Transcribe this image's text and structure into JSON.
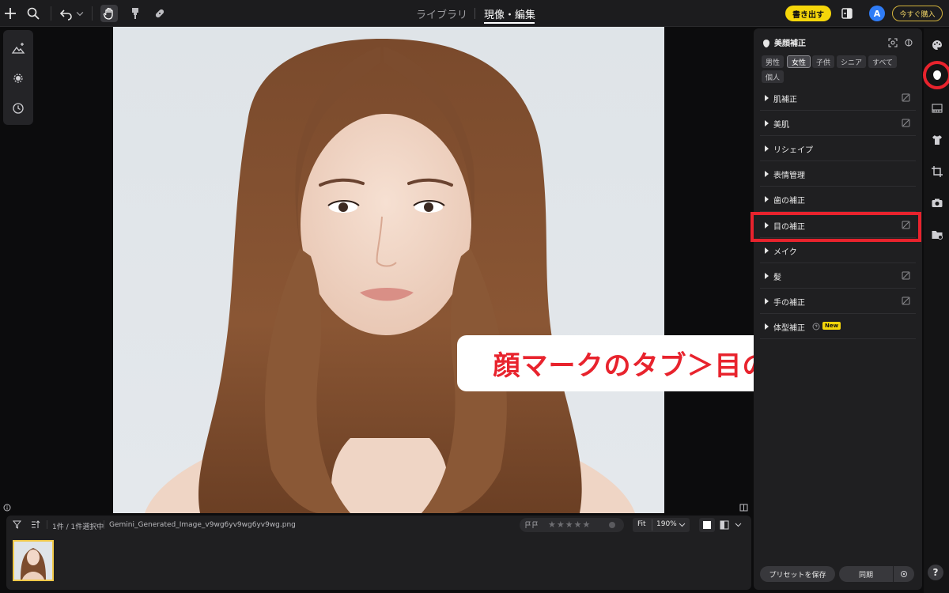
{
  "topbar": {
    "tab_library": "ライブラリ",
    "tab_develop": "現像・編集",
    "export_label": "書き出す",
    "avatar_letter": "A",
    "buy_label": "今すぐ購入"
  },
  "right_panel": {
    "title": "美顔補正",
    "chips": [
      "男性",
      "女性",
      "子供",
      "シニア",
      "すべて",
      "個人"
    ],
    "active_chip": "女性",
    "sections": [
      {
        "label": "肌補正",
        "eraser": true
      },
      {
        "label": "美肌",
        "eraser": true
      },
      {
        "label": "リシェイプ",
        "eraser": false
      },
      {
        "label": "表情管理",
        "eraser": false
      },
      {
        "label": "歯の補正",
        "eraser": false
      },
      {
        "label": "目の補正",
        "eraser": true
      },
      {
        "label": "メイク",
        "eraser": false
      },
      {
        "label": "髪",
        "eraser": true
      },
      {
        "label": "手の補正",
        "eraser": true
      },
      {
        "label": "体型補正",
        "eraser": false
      }
    ],
    "new_badge": "New",
    "save_preset_label": "プリセットを保存",
    "sync_label": "同期"
  },
  "filmstrip": {
    "count_text": "1件 / 1件選択中",
    "filename": "Gemini_Generated_Image_v9wg6yv9wg6yv9wg.png",
    "fit_label": "Fit",
    "zoom_value": "190%"
  },
  "caption": {
    "text": "顔マークのタブ＞目の補正"
  },
  "rail": {
    "help_label": "?"
  },
  "colors": {
    "accent_yellow": "#f5d60a",
    "highlight_red": "#e8232d",
    "avatar_blue": "#2f7cf6"
  }
}
